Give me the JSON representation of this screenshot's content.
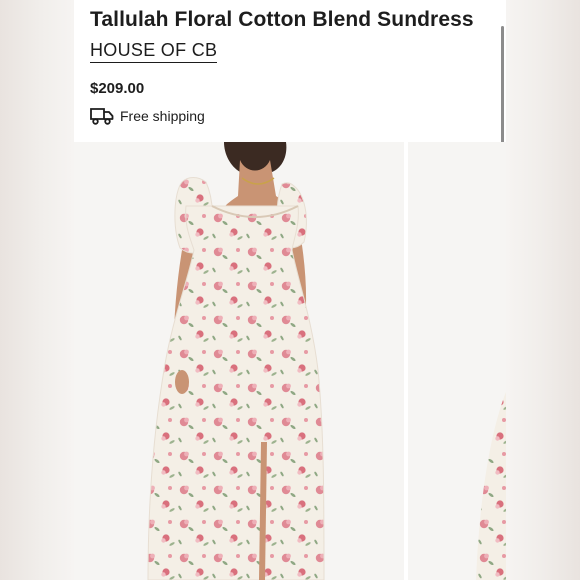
{
  "product": {
    "title": "Tallulah Floral Cotton Blend Sundress",
    "brand": "HOUSE OF CB",
    "price": "$209.00",
    "shipping": "Free shipping"
  },
  "icons": {
    "shipping": "truck-icon"
  },
  "colors": {
    "text": "#1d1d1d",
    "dress_base": "#f4efe6",
    "floral_pink": "#e08a95",
    "floral_leaf": "#8fa884",
    "photo_background": "#f6f5f3"
  },
  "gallery": {
    "images": [
      {
        "alt": "model-wearing-floral-dress-front"
      },
      {
        "alt": "floral-dress-second-image"
      }
    ]
  }
}
